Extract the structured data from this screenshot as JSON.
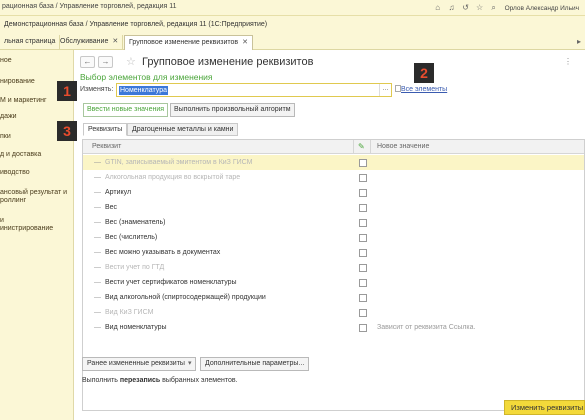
{
  "window": {
    "title": "рационная база / Управление торговлей, редакция 11",
    "user": "Орлов Александр Ильич",
    "icons": [
      "home-icon",
      "bell-icon",
      "history-icon",
      "star-icon",
      "search-icon"
    ]
  },
  "tabs": [
    {
      "label": "Демонстрационная база / Управление торговлей, редакция 11  (1С:Предприятие)",
      "active": false
    },
    {
      "label": "льная страница",
      "active": false
    },
    {
      "label": "Обслуживание",
      "active": false,
      "closable": true
    },
    {
      "label": "Групповое изменение реквизитов",
      "active": true,
      "closable": true
    }
  ],
  "sidebar": {
    "items": [
      "ное",
      "нирование",
      "М и маркетинг",
      "дажи",
      "пки",
      "д и доставка",
      "иводство",
      "ансовый результат и",
      "роллинг",
      "и",
      "инистрирование"
    ]
  },
  "document": {
    "title": "Групповое изменение реквизитов",
    "back": "←",
    "forward": "→",
    "menu": "⋮"
  },
  "selection": {
    "heading": "Выбор элементов для изменения",
    "label": "Изменять:",
    "value": "Номенклатура",
    "picker": "...",
    "all_link": "Все элементы"
  },
  "markers": [
    "1",
    "2",
    "3"
  ],
  "commands": {
    "enter_values": "Ввести новые значения",
    "run_algorithm": "Выполнить произвольный алгоритм"
  },
  "panel_tabs": [
    "Реквизиты",
    "Драгоценные металлы и камни"
  ],
  "grid": {
    "columns": [
      "Реквизит",
      "Новое значение"
    ],
    "rows": [
      {
        "name": "GTIN, записываемый эмитентом в КиЗ ГИСМ",
        "dim": true,
        "value": ""
      },
      {
        "name": "Алкогольная продукция во вскрытой таре",
        "dim": true,
        "value": ""
      },
      {
        "name": "Артикул",
        "dim": false,
        "value": ""
      },
      {
        "name": "Вес",
        "dim": false,
        "value": ""
      },
      {
        "name": "Вес (знаменатель)",
        "dim": false,
        "value": ""
      },
      {
        "name": "Вес (числитель)",
        "dim": false,
        "value": ""
      },
      {
        "name": "Вес можно указывать в документах",
        "dim": false,
        "value": ""
      },
      {
        "name": "Вести учет по ГТД",
        "dim": true,
        "value": ""
      },
      {
        "name": "Вести учет сертификатов номенклатуры",
        "dim": false,
        "value": ""
      },
      {
        "name": "Вид алкогольной (спиртосодержащей) продукции",
        "dim": false,
        "value": ""
      },
      {
        "name": "Вид КиЗ ГИСМ",
        "dim": true,
        "value": ""
      },
      {
        "name": "Вид номенклатуры",
        "dim": false,
        "value": "Зависит от реквизита Ссылка."
      }
    ]
  },
  "bottom": {
    "prev_button": "Ранее измененные реквизиты",
    "params_button": "Дополнительные параметры...",
    "footer_prefix": "Выполнить ",
    "footer_bold": "перезапись",
    "footer_suffix": " выбранных элементов.",
    "primary_button": "Изменить реквизиты"
  }
}
